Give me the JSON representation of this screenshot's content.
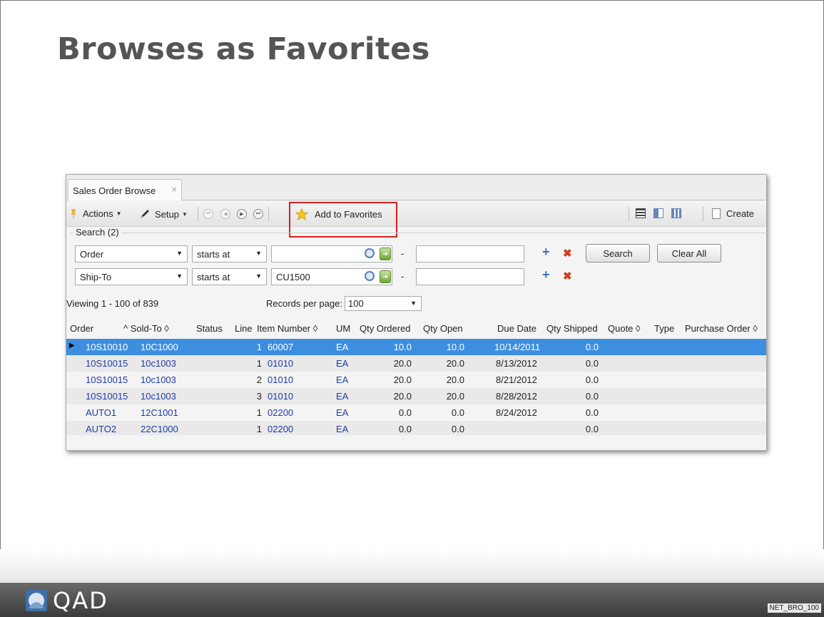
{
  "slide": {
    "title": "Browses as Favorites",
    "brand": "QAD",
    "code": "NET_BRO_100"
  },
  "window": {
    "tab_label": "Sales Order Browse",
    "tab_close": "×"
  },
  "toolbar": {
    "actions_label": "Actions",
    "setup_label": "Setup",
    "add_favorites_label": "Add to Favorites",
    "create_label": "Create",
    "nav_first": "⏮",
    "nav_prev": "◀",
    "nav_next": "▶",
    "nav_last": "⏭"
  },
  "search": {
    "legend": "Search (2)",
    "rows": [
      {
        "field": "Order",
        "operator": "starts at",
        "value": "",
        "to_value": ""
      },
      {
        "field": "Ship-To",
        "operator": "starts at",
        "value": "CU1500",
        "to_value": ""
      }
    ],
    "dash": "-",
    "search_button": "Search",
    "clear_button": "Clear All"
  },
  "paging": {
    "viewing": "Viewing  1 - 100  of  839",
    "records_label": "Records per page:",
    "records_value": "100"
  },
  "columns": [
    "Order",
    "^  Sold-To ◊",
    "Status",
    "Line",
    "Item Number ◊",
    "UM",
    "Qty Ordered",
    "Qty Open",
    "Due Date",
    "Qty Shipped",
    "Quote ◊",
    "Type",
    "Purchase Order ◊"
  ],
  "rows": [
    {
      "order": "10S10010",
      "sold_to": "10C1000",
      "line": "1",
      "item": "60007",
      "um": "EA",
      "qty_ordered": "10.0",
      "qty_open": "10.0",
      "due": "10/14/2011",
      "qty_shipped": "0.0"
    },
    {
      "order": "10S10015",
      "sold_to": "10c1003",
      "line": "1",
      "item": "01010",
      "um": "EA",
      "qty_ordered": "20.0",
      "qty_open": "20.0",
      "due": "8/13/2012",
      "qty_shipped": "0.0"
    },
    {
      "order": "10S10015",
      "sold_to": "10c1003",
      "line": "2",
      "item": "01010",
      "um": "EA",
      "qty_ordered": "20.0",
      "qty_open": "20.0",
      "due": "8/21/2012",
      "qty_shipped": "0.0"
    },
    {
      "order": "10S10015",
      "sold_to": "10c1003",
      "line": "3",
      "item": "01010",
      "um": "EA",
      "qty_ordered": "20.0",
      "qty_open": "20.0",
      "due": "8/28/2012",
      "qty_shipped": "0.0"
    },
    {
      "order": "AUTO1",
      "sold_to": "12C1001",
      "line": "1",
      "item": "02200",
      "um": "EA",
      "qty_ordered": "0.0",
      "qty_open": "0.0",
      "due": "8/24/2012",
      "qty_shipped": "0.0"
    },
    {
      "order": "AUTO2",
      "sold_to": "22C1000",
      "line": "1",
      "item": "02200",
      "um": "EA",
      "qty_ordered": "0.0",
      "qty_open": "0.0",
      "due": "",
      "qty_shipped": "0.0"
    }
  ],
  "colors": {
    "selection": "#3e8ee0",
    "link": "#1e3ba8",
    "highlight_box": "#d42020"
  }
}
